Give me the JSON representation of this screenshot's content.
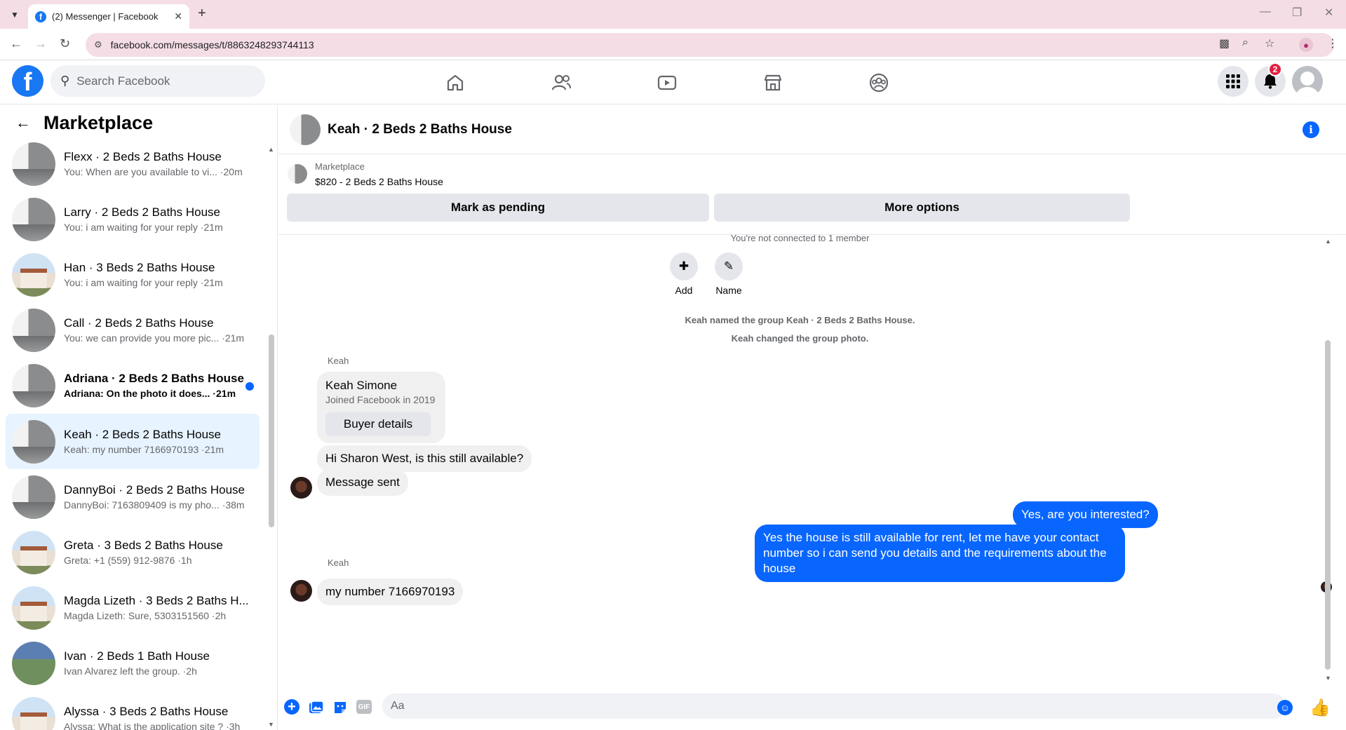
{
  "browser": {
    "tab_title": "(2) Messenger | Facebook",
    "url": "facebook.com/messages/t/8863248293744113"
  },
  "fb": {
    "search_placeholder": "Search Facebook",
    "notification_count": "2"
  },
  "sidebar": {
    "title": "Marketplace",
    "conversations": [
      {
        "name": "Flexx · 2 Beds 2 Baths House",
        "preview": "You: When are you available to vi... ·20m",
        "thumb": "room"
      },
      {
        "name": "Larry · 2 Beds 2 Baths House",
        "preview": "You: i am waiting for your reply ·21m",
        "thumb": "room"
      },
      {
        "name": "Han · 3 Beds 2 Baths House",
        "preview": "You: i am waiting for your reply ·21m",
        "thumb": "house"
      },
      {
        "name": "Call · 2 Beds 2 Baths House",
        "preview": "You: we can provide you more pic... ·21m",
        "thumb": "room"
      },
      {
        "name": "Adriana · 2 Beds 2 Baths House",
        "preview": "Adriana: On the photo it does... ·21m",
        "thumb": "room",
        "unread": true
      },
      {
        "name": "Keah · 2 Beds 2 Baths House",
        "preview": "Keah: my number 7166970193 ·21m",
        "thumb": "room",
        "active": true
      },
      {
        "name": "DannyBoi · 2 Beds 2 Baths House",
        "preview": "DannyBoi: 7163809409 is my pho... ·38m",
        "thumb": "room"
      },
      {
        "name": "Greta · 3 Beds 2 Baths House",
        "preview": "Greta: +1 (559) 912-9876 ·1h",
        "thumb": "house"
      },
      {
        "name": "Magda Lizeth · 3 Beds 2 Baths H...",
        "preview": "Magda Lizeth: Sure, 5303151560 ·2h",
        "thumb": "house"
      },
      {
        "name": "Ivan · 2 Beds 1 Bath House",
        "preview": "Ivan Alvarez left the group. ·2h",
        "thumb": "ivan"
      },
      {
        "name": "Alyssa · 3 Beds 2 Baths House",
        "preview": "Alyssa: What is the application site ? ·3h",
        "thumb": "house"
      }
    ]
  },
  "chat": {
    "title": "Keah · 2 Beds 2 Baths House",
    "marketplace_label": "Marketplace",
    "listing": "$820 - 2 Beds 2 Baths House",
    "mark_pending": "Mark as pending",
    "more_options": "More options",
    "not_connected": "You're not connected to 1 member",
    "add_label": "Add",
    "name_label": "Name",
    "sys_named": "Keah named the group Keah · 2 Beds 2 Baths House.",
    "sys_photo": "Keah changed the group photo.",
    "sender1": "Keah",
    "card_name": "Keah Simone",
    "card_sub": "Joined Facebook in 2019",
    "card_btn": "Buyer details",
    "msg1": "Hi Sharon West, is this still available?",
    "msg2": "Message sent",
    "my_msg1": "Yes, are you interested?",
    "my_msg2": "Yes the house is still available for rent, let me have your contact number so i can send you details and the requirements about the house",
    "sender2": "Keah",
    "msg3": "my number 7166970193",
    "composer_placeholder": "Aa",
    "gif_label": "GIF"
  }
}
